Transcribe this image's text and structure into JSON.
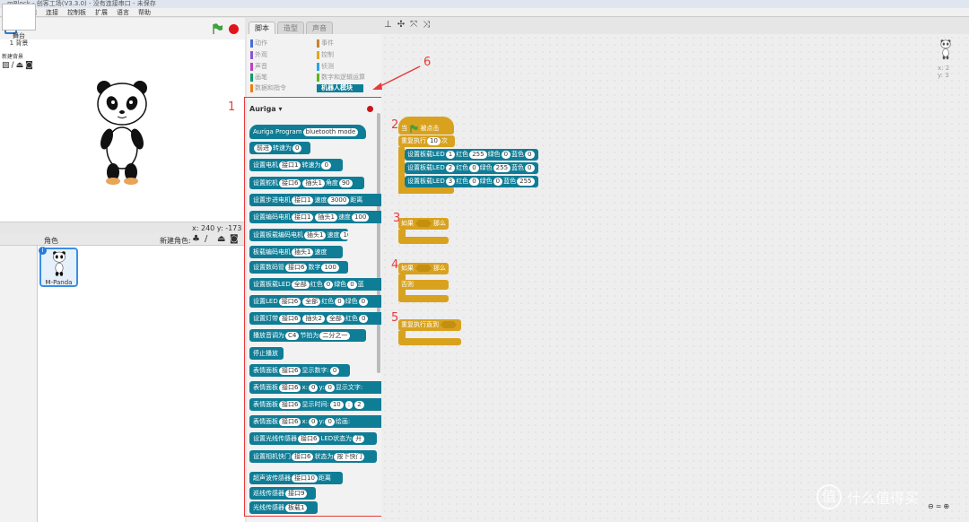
{
  "window": {
    "title": "mBlock - 创客工场(V3.3.0) - 没有连接串口 - 未保存"
  },
  "menu": [
    "文件",
    "编辑",
    "连接",
    "控制板",
    "扩展",
    "语言",
    "帮助"
  ],
  "stage": {
    "coords": "x: 240  y: -173"
  },
  "sprites_pane": {
    "header": "角色",
    "new_sprite_label": "新建角色:",
    "stage_label": "舞台\n1 背景",
    "new_backdrop_label": "新建背景",
    "sprite_name": "M-Panda",
    "info_badge": "i"
  },
  "tabs": [
    "脚本",
    "造型",
    "声音"
  ],
  "categories": [
    {
      "label": "动作",
      "color": "#4a6cd4"
    },
    {
      "label": "外观",
      "color": "#8a55d7"
    },
    {
      "label": "声音",
      "color": "#bb42c3"
    },
    {
      "label": "画笔",
      "color": "#0e9a6c"
    },
    {
      "label": "数据和指令",
      "color": "#ee7d16"
    },
    {
      "label": "事件",
      "color": "#c88330"
    },
    {
      "label": "控制",
      "color": "#e1a91a"
    },
    {
      "label": "侦测",
      "color": "#2ca5e2"
    },
    {
      "label": "数字和逻辑运算",
      "color": "#5cb712"
    },
    {
      "label": "机器人模块",
      "color": "#0e7e96"
    }
  ],
  "palette": {
    "board": "Auriga",
    "blocks": [
      [
        "Auriga Program",
        "bluetooth mode"
      ],
      [
        "前进",
        "转速为",
        "0"
      ],
      [
        "设置电机",
        "接口1",
        "转速为",
        "0"
      ],
      [
        "设置舵机",
        "接口6",
        "插头1",
        "角度",
        "90"
      ],
      [
        "设置步进电机",
        "接口1",
        "速度",
        "3000",
        "距离"
      ],
      [
        "设置编码电机",
        "接口1",
        "插头1",
        "速度",
        "100"
      ],
      [
        "设置板载编码电机",
        "插头1",
        "速度",
        "100"
      ],
      [
        "板载编码电机",
        "插头1",
        "速度"
      ],
      [
        "设置数码管",
        "接口6",
        "数字",
        "100"
      ],
      [
        "设置板载LED",
        "全部",
        "红色",
        "0",
        "绿色",
        "0",
        "蓝"
      ],
      [
        "设置LED",
        "接口6",
        "全部",
        "红色",
        "0",
        "绿色",
        "0"
      ],
      [
        "设置灯带",
        "接口6",
        "插头2",
        "全部",
        "红色",
        "0"
      ],
      [
        "播放",
        "音调为",
        "C4",
        "节拍为",
        "二分之一"
      ],
      [
        "停止播放"
      ],
      [
        "表情面板",
        "接口6",
        "显示数字:",
        "0"
      ],
      [
        "表情面板",
        "接口6",
        "x:",
        "0",
        "y:",
        "0",
        "显示文字:"
      ],
      [
        "表情面板",
        "接口6",
        "显示时间:",
        "10",
        ":",
        "2"
      ],
      [
        "表情面板",
        "接口6",
        "x:",
        "0",
        "y:",
        "0",
        "绘画:"
      ],
      [
        "设置光线传感器",
        "接口6",
        "LED状态为",
        "开"
      ],
      [
        "设置相机快门",
        "接口6",
        "状态为",
        "按下快门"
      ],
      [
        "超声波传感器",
        "接口10",
        "距离"
      ],
      [
        "巡线传感器",
        "接口9"
      ],
      [
        "光线传感器",
        "板载1"
      ]
    ]
  },
  "script": {
    "hat": {
      "when": "当",
      "clicked": "被点击"
    },
    "repeat": {
      "label": "重复执行",
      "count": "10",
      "unit": "次"
    },
    "leds": [
      [
        "设置板载LED",
        "1",
        "红色",
        "255",
        "绿色",
        "0",
        "蓝色",
        "0"
      ],
      [
        "设置板载LED",
        "2",
        "红色",
        "0",
        "绿色",
        "255",
        "蓝色",
        "0"
      ],
      [
        "设置板载LED",
        "3",
        "红色",
        "0",
        "绿色",
        "0",
        "蓝色",
        "255"
      ]
    ],
    "if1": {
      "if": "如果",
      "then": "那么"
    },
    "if2": {
      "if": "如果",
      "then": "那么",
      "else": "否则"
    },
    "until": {
      "label": "重复执行直到"
    }
  },
  "annotations": [
    "1",
    "2",
    "3",
    "4",
    "5",
    "6"
  ],
  "sprite_xy": {
    "x": "x: 2",
    "y": "y: 3"
  },
  "watermark": {
    "logo": "值",
    "text": "什么值得买"
  }
}
